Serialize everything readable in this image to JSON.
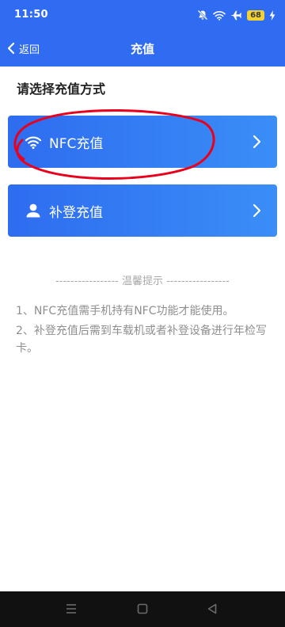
{
  "status_bar": {
    "time": "11:50",
    "battery": "68",
    "icons": [
      "mute-bell-icon",
      "wifi-icon",
      "airplane-icon",
      "battery-icon",
      "charging-bolt-icon"
    ]
  },
  "nav": {
    "back_label": "返回",
    "title": "充值"
  },
  "content": {
    "section_title": "请选择充值方式",
    "options": [
      {
        "label": "NFC充值",
        "icon": "wifi-icon"
      },
      {
        "label": "补登充值",
        "icon": "person-icon"
      }
    ],
    "tip_header": "----------------- 温馨提示 -----------------",
    "tips": [
      "1、NFC充值需手机持有NFC功能才能使用。",
      "2、补登充值后需到车载机或者补登设备进行年检写卡。"
    ]
  },
  "colors": {
    "primary": "#2f6cf1",
    "button_gradient_end": "#3a8ef6",
    "annotation_red": "#e8001c",
    "tip_text": "#8f8f8f"
  },
  "system_nav": {
    "icons": [
      "menu-icon",
      "home-icon",
      "back-triangle-icon"
    ]
  }
}
